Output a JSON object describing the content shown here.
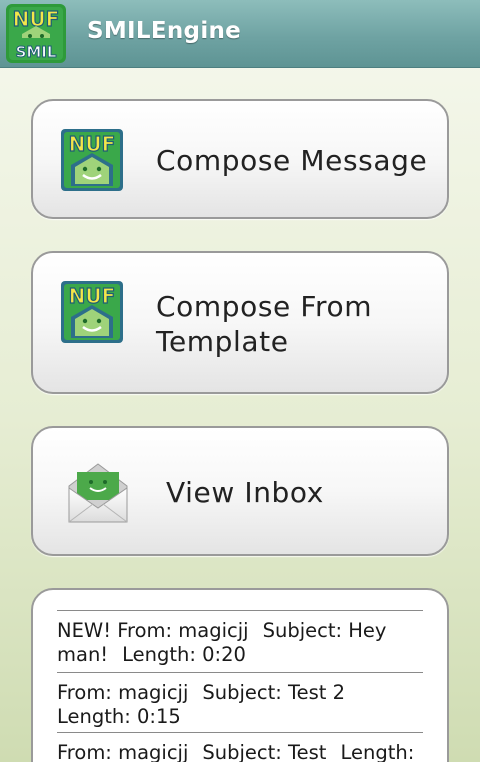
{
  "app": {
    "title": "SMILEngine"
  },
  "buttons": {
    "compose": "Compose Message",
    "template_line1": "Compose From",
    "template_line2": "Template",
    "inbox": "View Inbox"
  },
  "logo": {
    "top": "NUF",
    "bottom": "SMIL"
  },
  "messages": [
    {
      "prefix": "NEW! ",
      "from": "From: magicjj",
      "subject": "Subject: Hey man!",
      "length": "Length: 0:20"
    },
    {
      "prefix": "",
      "from": "From: magicjj",
      "subject": "Subject: Test 2",
      "length": "Length: 0:15"
    },
    {
      "prefix": "",
      "from": "From: magicjj",
      "subject": "Subject: Test",
      "length": "Length:"
    }
  ],
  "colors": {
    "accent": "#6fa3a3",
    "brand_green": "#2e9a3a",
    "brand_teal": "#2d6f8a",
    "logo_yellow": "#f4e64a"
  }
}
